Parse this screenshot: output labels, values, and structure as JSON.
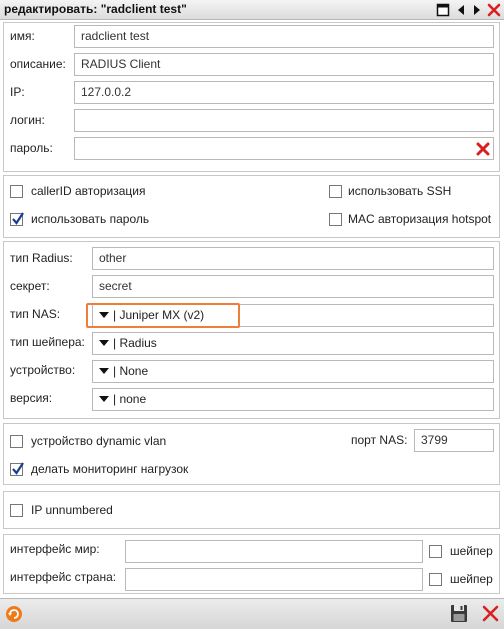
{
  "window": {
    "title": "редактировать: \"radclient test\"",
    "icons": [
      "maximize-icon",
      "prev-icon",
      "next-icon",
      "close-icon"
    ]
  },
  "main": {
    "name_label": "имя:",
    "name_value": "radclient test",
    "desc_label": "описание:",
    "desc_value": "RADIUS Client",
    "ip_label": "IP:",
    "ip_value": "127.0.0.2",
    "login_label": "логин:",
    "login_value": "",
    "password_label": "пароль:",
    "password_value": ""
  },
  "options": {
    "callerid_label": "callerID авторизация",
    "callerid_checked": false,
    "ssh_label": "использовать SSH",
    "ssh_checked": false,
    "use_password_label": "использовать пароль",
    "use_password_checked": true,
    "mac_auth_label": "MAC авторизация hotspot",
    "mac_auth_checked": false
  },
  "radius": {
    "type_label": "тип Radius:",
    "type_value": "other",
    "secret_label": "секрет:",
    "secret_value": "secret",
    "nas_type_label": "тип NAS:",
    "nas_type_value": "| Juniper MX (v2)",
    "shaper_type_label": "тип шейпера:",
    "shaper_type_value": "| Radius",
    "device_label": "устройство:",
    "device_value": "| None",
    "version_label": "версия:",
    "version_value": "| none"
  },
  "vlan": {
    "dynamic_vlan_label": "устройство dynamic vlan",
    "dynamic_vlan_checked": false,
    "monitoring_label": "делать мониторинг нагрузок",
    "monitoring_checked": true,
    "nas_port_label": "порт NAS:",
    "nas_port_value": "3799"
  },
  "unnumbered": {
    "label": "IP unnumbered",
    "checked": false
  },
  "interfaces": {
    "world_label": "интерфейс мир:",
    "world_value": "",
    "world_shaper_label": "шейпер",
    "world_shaper_checked": false,
    "country_label": "интерфейс страна:",
    "country_value": "",
    "country_shaper_label": "шейпер",
    "country_shaper_checked": false
  },
  "colors": {
    "accent_orange": "#ee7f3b",
    "close_red": "#d92020",
    "check_blue": "#1a3f8f"
  },
  "bottombar": {
    "icons": [
      "refresh-icon",
      "save-icon",
      "close-icon"
    ]
  }
}
